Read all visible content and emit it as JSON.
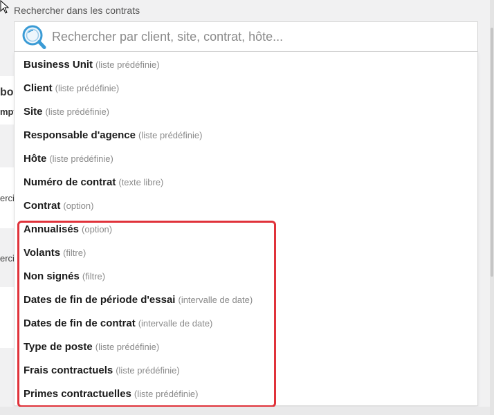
{
  "search": {
    "label": "Rechercher dans les contrats",
    "placeholder": "Rechercher par client, site, contrat, hôte..."
  },
  "background": {
    "fragment_1": "bo",
    "fragment_2": "mpt",
    "fragment_3": "erci",
    "fragment_4": "erci"
  },
  "options": [
    {
      "name": "Business Unit",
      "type": "(liste prédéfinie)"
    },
    {
      "name": "Client",
      "type": "(liste prédéfinie)"
    },
    {
      "name": "Site",
      "type": "(liste prédéfinie)"
    },
    {
      "name": "Responsable d'agence",
      "type": "(liste prédéfinie)"
    },
    {
      "name": "Hôte",
      "type": "(liste prédéfinie)"
    },
    {
      "name": "Numéro de contrat",
      "type": "(texte libre)"
    },
    {
      "name": "Contrat",
      "type": "(option)"
    },
    {
      "name": "Annualisés",
      "type": "(option)"
    },
    {
      "name": "Volants",
      "type": "(filtre)"
    },
    {
      "name": "Non signés",
      "type": "(filtre)"
    },
    {
      "name": "Dates de fin de période d'essai",
      "type": "(intervalle de date)"
    },
    {
      "name": "Dates de fin de contrat",
      "type": "(intervalle de date)"
    },
    {
      "name": "Type de poste",
      "type": "(liste prédéfinie)"
    },
    {
      "name": "Frais contractuels",
      "type": "(liste prédéfinie)"
    },
    {
      "name": "Primes contractuelles",
      "type": "(liste prédéfinie)"
    }
  ],
  "colors": {
    "highlight": "#e0323a",
    "search_icon": "#3a9bd5"
  }
}
